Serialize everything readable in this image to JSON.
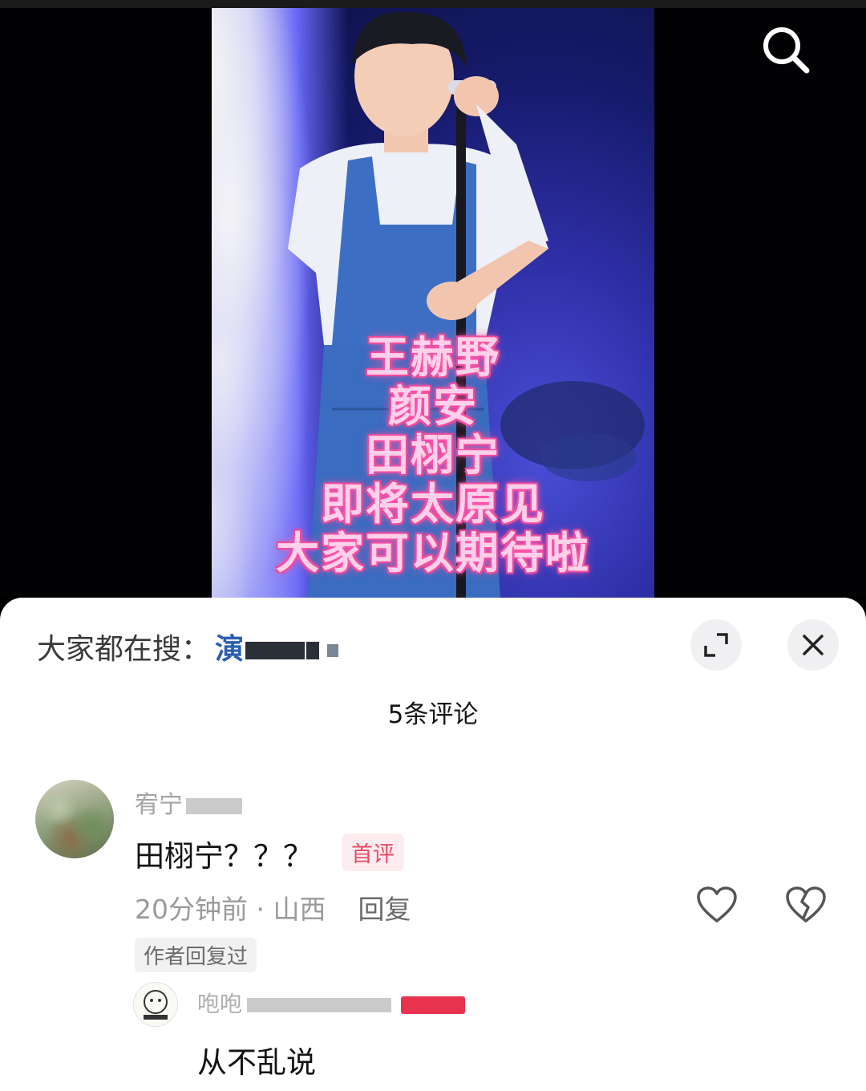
{
  "video": {
    "overlay_lines": [
      "王赫野",
      "颜安",
      "田栩宁",
      "即将太原见",
      "大家可以期待啦"
    ]
  },
  "icons": {
    "search": "search-icon",
    "expand": "expand-icon",
    "close": "close-icon",
    "like": "heart-icon",
    "dislike": "broken-heart-icon"
  },
  "sheet": {
    "everyone_search_label": "大家都在搜：",
    "everyone_search_keyword": "演",
    "comment_count": "5条评论"
  },
  "comments": [
    {
      "username": "宥宁",
      "text": "田栩宁？？？",
      "badge": "首评",
      "time": "20分钟前",
      "region": "山西",
      "reply_label": "回复",
      "author_replied": "作者回复过",
      "replies": [
        {
          "username": "咆咆",
          "text": "从不乱说"
        }
      ]
    }
  ],
  "colors": {
    "overlay_text": "#ffd0ea",
    "overlay_glow": "#ff4fa4",
    "first_badge_bg": "#fdecef",
    "first_badge_text": "#e84a62",
    "keyword": "#2b5fb0"
  }
}
